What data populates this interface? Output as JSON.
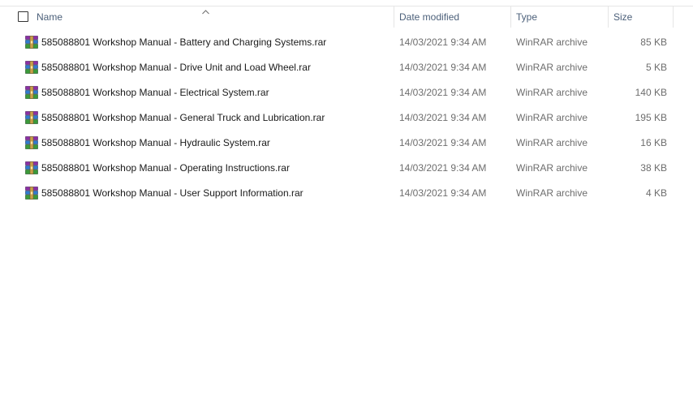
{
  "columns": {
    "name": "Name",
    "date_modified": "Date modified",
    "type": "Type",
    "size": "Size"
  },
  "sort": {
    "column": "name",
    "direction": "ascending",
    "icon": "chevron-up-icon"
  },
  "files": [
    {
      "name": "585088801 Workshop Manual - Battery and Charging Systems.rar",
      "date": "14/03/2021 9:34 AM",
      "type": "WinRAR archive",
      "size": "85 KB",
      "icon": "winrar-archive-icon"
    },
    {
      "name": "585088801 Workshop Manual - Drive Unit and Load Wheel.rar",
      "date": "14/03/2021 9:34 AM",
      "type": "WinRAR archive",
      "size": "5 KB",
      "icon": "winrar-archive-icon"
    },
    {
      "name": "585088801 Workshop Manual - Electrical System.rar",
      "date": "14/03/2021 9:34 AM",
      "type": "WinRAR archive",
      "size": "140 KB",
      "icon": "winrar-archive-icon"
    },
    {
      "name": "585088801 Workshop Manual - General Truck and Lubrication.rar",
      "date": "14/03/2021 9:34 AM",
      "type": "WinRAR archive",
      "size": "195 KB",
      "icon": "winrar-archive-icon"
    },
    {
      "name": "585088801 Workshop Manual - Hydraulic System.rar",
      "date": "14/03/2021 9:34 AM",
      "type": "WinRAR archive",
      "size": "16 KB",
      "icon": "winrar-archive-icon"
    },
    {
      "name": "585088801 Workshop Manual - Operating Instructions.rar",
      "date": "14/03/2021 9:34 AM",
      "type": "WinRAR archive",
      "size": "38 KB",
      "icon": "winrar-archive-icon"
    },
    {
      "name": "585088801 Workshop Manual - User Support Information.rar",
      "date": "14/03/2021 9:34 AM",
      "type": "WinRAR archive",
      "size": "4 KB",
      "icon": "winrar-archive-icon"
    }
  ]
}
